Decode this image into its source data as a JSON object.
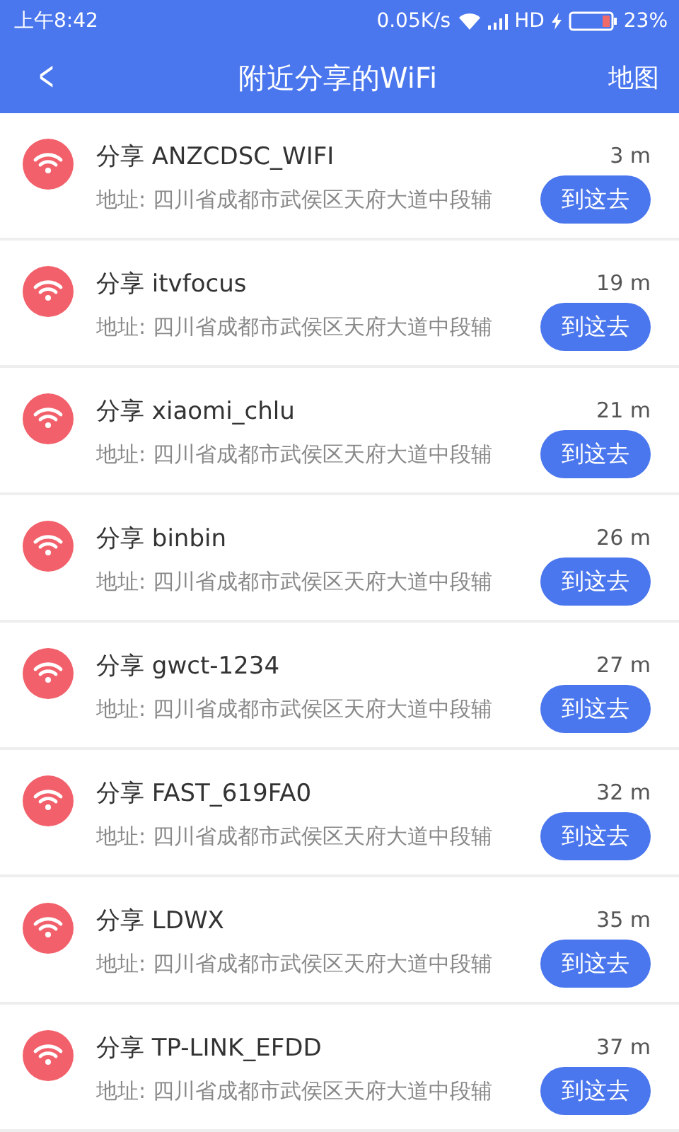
{
  "status_bar": {
    "time": "上午8:42",
    "speed": "0.05K/s",
    "network": "HD",
    "battery": "23%"
  },
  "header": {
    "back": "<",
    "title": "附近分享的WiFi",
    "action": "地图"
  },
  "items": [
    {
      "name": "分享 ANZCDSC_WIFI",
      "address": "地址: 四川省成都市武侯区天府大道中段辅",
      "distance": "3 m",
      "button": "到这去"
    },
    {
      "name": "分享 itvfocus",
      "address": "地址: 四川省成都市武侯区天府大道中段辅",
      "distance": "19 m",
      "button": "到这去"
    },
    {
      "name": "分享 xiaomi_chlu",
      "address": "地址: 四川省成都市武侯区天府大道中段辅",
      "distance": "21 m",
      "button": "到这去"
    },
    {
      "name": "分享 binbin",
      "address": "地址: 四川省成都市武侯区天府大道中段辅",
      "distance": "26 m",
      "button": "到这去"
    },
    {
      "name": "分享 gwct-1234",
      "address": "地址: 四川省成都市武侯区天府大道中段辅",
      "distance": "27 m",
      "button": "到这去"
    },
    {
      "name": "分享 FAST_619FA0",
      "address": "地址: 四川省成都市武侯区天府大道中段辅",
      "distance": "32 m",
      "button": "到这去"
    },
    {
      "name": "分享 LDWX",
      "address": "地址: 四川省成都市武侯区天府大道中段辅",
      "distance": "35 m",
      "button": "到这去"
    },
    {
      "name": "分享 TP-LINK_EFDD",
      "address": "地址: 四川省成都市武侯区天府大道中段辅",
      "distance": "37 m",
      "button": "到这去"
    }
  ]
}
